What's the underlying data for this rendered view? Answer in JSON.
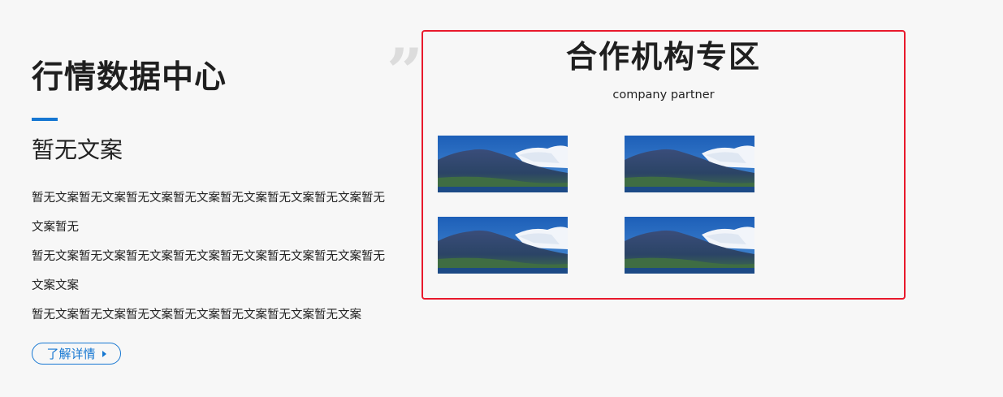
{
  "intro": {
    "title": "行情数据中心",
    "quote_mark": "”",
    "subtitle": "暂无文案",
    "paragraph_lines": [
      "暂无文案暂无文案暂无文案暂无文案暂无文案暂无文案暂无文案暂无",
      "文案暂无",
      "暂无文案暂无文案暂无文案暂无文案暂无文案暂无文案暂无文案暂无",
      "文案文案",
      "暂无文案暂无文案暂无文案暂无文案暂无文案暂无文案暂无文案"
    ],
    "more_button_label": "了解详情"
  },
  "partners": {
    "title": "合作机构专区",
    "subtitle": "company partner",
    "logos": [
      {
        "image": "mountain-landscape"
      },
      {
        "image": "mountain-landscape"
      },
      {
        "image": "mountain-landscape"
      },
      {
        "image": "mountain-landscape"
      }
    ]
  },
  "colors": {
    "accent": "#1677d2",
    "highlight_border": "#e8192c",
    "background": "#f7f7f7",
    "quote_mark": "#dcdcdc"
  }
}
